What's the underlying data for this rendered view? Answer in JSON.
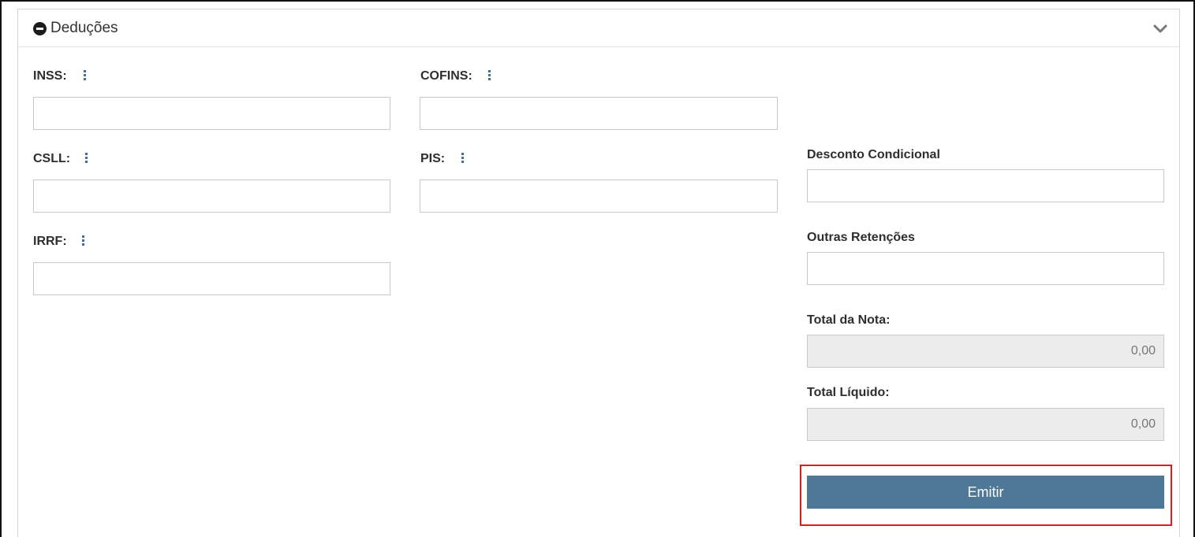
{
  "section": {
    "title": "Deduções"
  },
  "fields": {
    "inss": {
      "label": "INSS:",
      "value": ""
    },
    "cofins": {
      "label": "COFINS:",
      "value": ""
    },
    "csll": {
      "label": "CSLL:",
      "value": ""
    },
    "pis": {
      "label": "PIS:",
      "value": ""
    },
    "irrf": {
      "label": "IRRF:",
      "value": ""
    },
    "desconto_condicional": {
      "label": "Desconto Condicional",
      "value": ""
    },
    "outras_retencoes": {
      "label": "Outras Retenções",
      "value": ""
    },
    "total_nota": {
      "label": "Total da Nota:",
      "value": "0,00"
    },
    "total_liquido": {
      "label": "Total Líquido:",
      "value": "0,00"
    }
  },
  "actions": {
    "emit_label": "Emitir"
  },
  "colors": {
    "accent": "#4f7898",
    "highlight": "#e01b1b",
    "info_icon": "#3a6ea5"
  },
  "icons": {
    "collapse": "minus-circle-icon",
    "toggle": "chevron-down-icon",
    "field_info": "kebab-icon"
  }
}
